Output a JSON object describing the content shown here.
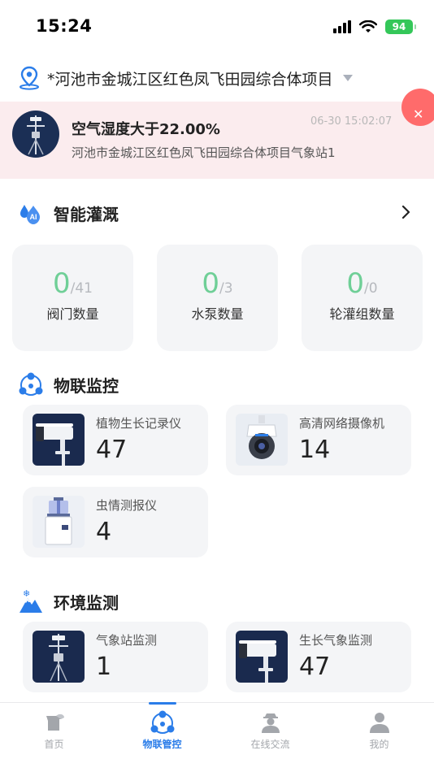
{
  "status": {
    "time": "15:24",
    "battery": "94"
  },
  "project": {
    "name": "*河池市金城江区红色凤飞田园综合体项目"
  },
  "alert": {
    "title": "空气湿度大于22.00%",
    "time": "06-30 15:02:07",
    "subtitle": "河池市金城江区红色凤飞田园综合体项目气象站1"
  },
  "irrigation": {
    "title": "智能灌溉",
    "icon_badge": "AI",
    "stats": [
      {
        "value": "0",
        "total": "/41",
        "label": "阀门数量"
      },
      {
        "value": "0",
        "total": "/3",
        "label": "水泵数量"
      },
      {
        "value": "0",
        "total": "/0",
        "label": "轮灌组数量"
      }
    ]
  },
  "iot": {
    "title": "物联监控",
    "devices": [
      {
        "name": "植物生长记录仪",
        "count": "47",
        "icon": "camera-bullet-icon"
      },
      {
        "name": "高清网络摄像机",
        "count": "14",
        "icon": "camera-dome-icon"
      },
      {
        "name": "虫情测报仪",
        "count": "4",
        "icon": "insect-monitor-icon"
      }
    ]
  },
  "env": {
    "title": "环境监测",
    "devices": [
      {
        "name": "气象站监测",
        "count": "1",
        "icon": "weather-station-icon"
      },
      {
        "name": "生长气象监测",
        "count": "47",
        "icon": "camera-bullet-icon"
      }
    ]
  },
  "tabs": [
    {
      "label": "首页",
      "icon": "home-icon",
      "active": false
    },
    {
      "label": "物联管控",
      "icon": "iot-icon",
      "active": true
    },
    {
      "label": "在线交流",
      "icon": "chat-person-icon",
      "active": false
    },
    {
      "label": "我的",
      "icon": "user-icon",
      "active": false
    }
  ],
  "colors": {
    "accent": "#2b7de9",
    "stat_green": "#6fcf97",
    "alert_bg": "#fbecee",
    "close_red": "#ff6b6b"
  }
}
